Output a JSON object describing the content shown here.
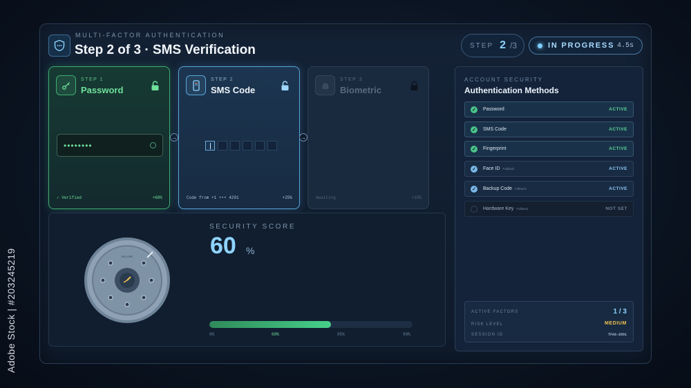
{
  "header": {
    "subtitle": "MULTI-FACTOR AUTHENTICATION",
    "title": "Step 2 of 3 · SMS Verification",
    "step_label": "STEP",
    "step_current": "2",
    "step_total": "/3",
    "status": "IN PROGRESS",
    "elapsed": "4.5s"
  },
  "steps": [
    {
      "label": "STEP 1",
      "title": "Password",
      "state": "verified",
      "footer_left": "✓ Verified",
      "footer_right": "+60%",
      "masked_value": "••••••••"
    },
    {
      "label": "STEP 2",
      "title": "SMS Code",
      "state": "active",
      "footer_left": "Code from +1 ••• 4291",
      "footer_right": "+25%",
      "code_length": 6
    },
    {
      "label": "STEP 3",
      "title": "Biometric",
      "state": "locked",
      "footer_left": "Awaiting",
      "footer_right": "+15%"
    }
  ],
  "score": {
    "label": "SECURITY SCORE",
    "value": "60",
    "unit": "%",
    "fraction": 0.6,
    "dial_label": "SECURE",
    "ticks": [
      "0%",
      "60%",
      "85%",
      "99%"
    ]
  },
  "account": {
    "subtitle": "ACCOUNT SECURITY",
    "title": "Authentication Methods",
    "methods": [
      {
        "name": "Password",
        "tag": "",
        "status": "ACTIVE"
      },
      {
        "name": "SMS Code",
        "tag": "",
        "status": "ACTIVE"
      },
      {
        "name": "Fingerprint",
        "tag": "",
        "status": "ACTIVE"
      },
      {
        "name": "Face ID",
        "tag": "Fallback",
        "status": "ACTIVE"
      },
      {
        "name": "Backup Code",
        "tag": "Fallback",
        "status": "ACTIVE"
      },
      {
        "name": "Hardware Key",
        "tag": "Fallback",
        "status": "NOT SET"
      }
    ],
    "summary": {
      "factors_label": "ACTIVE FACTORS",
      "factors_value": "1 / 3",
      "risk_label": "RISK LEVEL",
      "risk_value": "MEDIUM",
      "session_label": "SESSION ID",
      "session_value": "TFA6-2891"
    }
  },
  "colors": {
    "accent": "#8fd3ff",
    "verified": "#6ee09a",
    "warning": "#f2c14e"
  },
  "watermark": {
    "side_text": "Adobe Stock | #203245219"
  }
}
